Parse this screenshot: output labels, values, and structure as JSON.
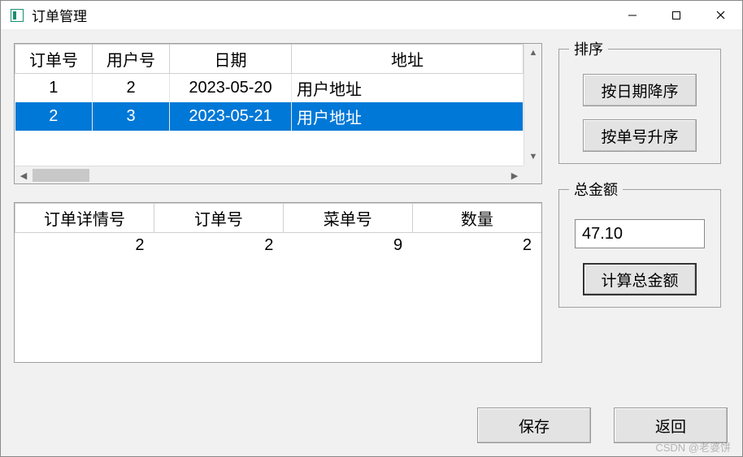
{
  "window": {
    "title": "订单管理"
  },
  "orders_table": {
    "headers": [
      "订单号",
      "用户号",
      "日期",
      "地址"
    ],
    "rows": [
      {
        "order_id": "1",
        "user_id": "2",
        "date": "2023-05-20",
        "address": "用户地址",
        "selected": false
      },
      {
        "order_id": "2",
        "user_id": "3",
        "date": "2023-05-21",
        "address": "用户地址",
        "selected": true
      }
    ]
  },
  "details_table": {
    "headers": [
      "订单详情号",
      "订单号",
      "菜单号",
      "数量"
    ],
    "rows": [
      {
        "detail_id": "2",
        "order_id": "2",
        "menu_id": "9",
        "qty": "2"
      }
    ]
  },
  "sort_group": {
    "legend": "排序",
    "by_date_desc": "按日期降序",
    "by_id_asc": "按单号升序"
  },
  "total_group": {
    "legend": "总金额",
    "value": "47.10",
    "calc_label": "计算总金额"
  },
  "buttons": {
    "save": "保存",
    "back": "返回"
  },
  "watermark": "CSDN @老婆饼"
}
